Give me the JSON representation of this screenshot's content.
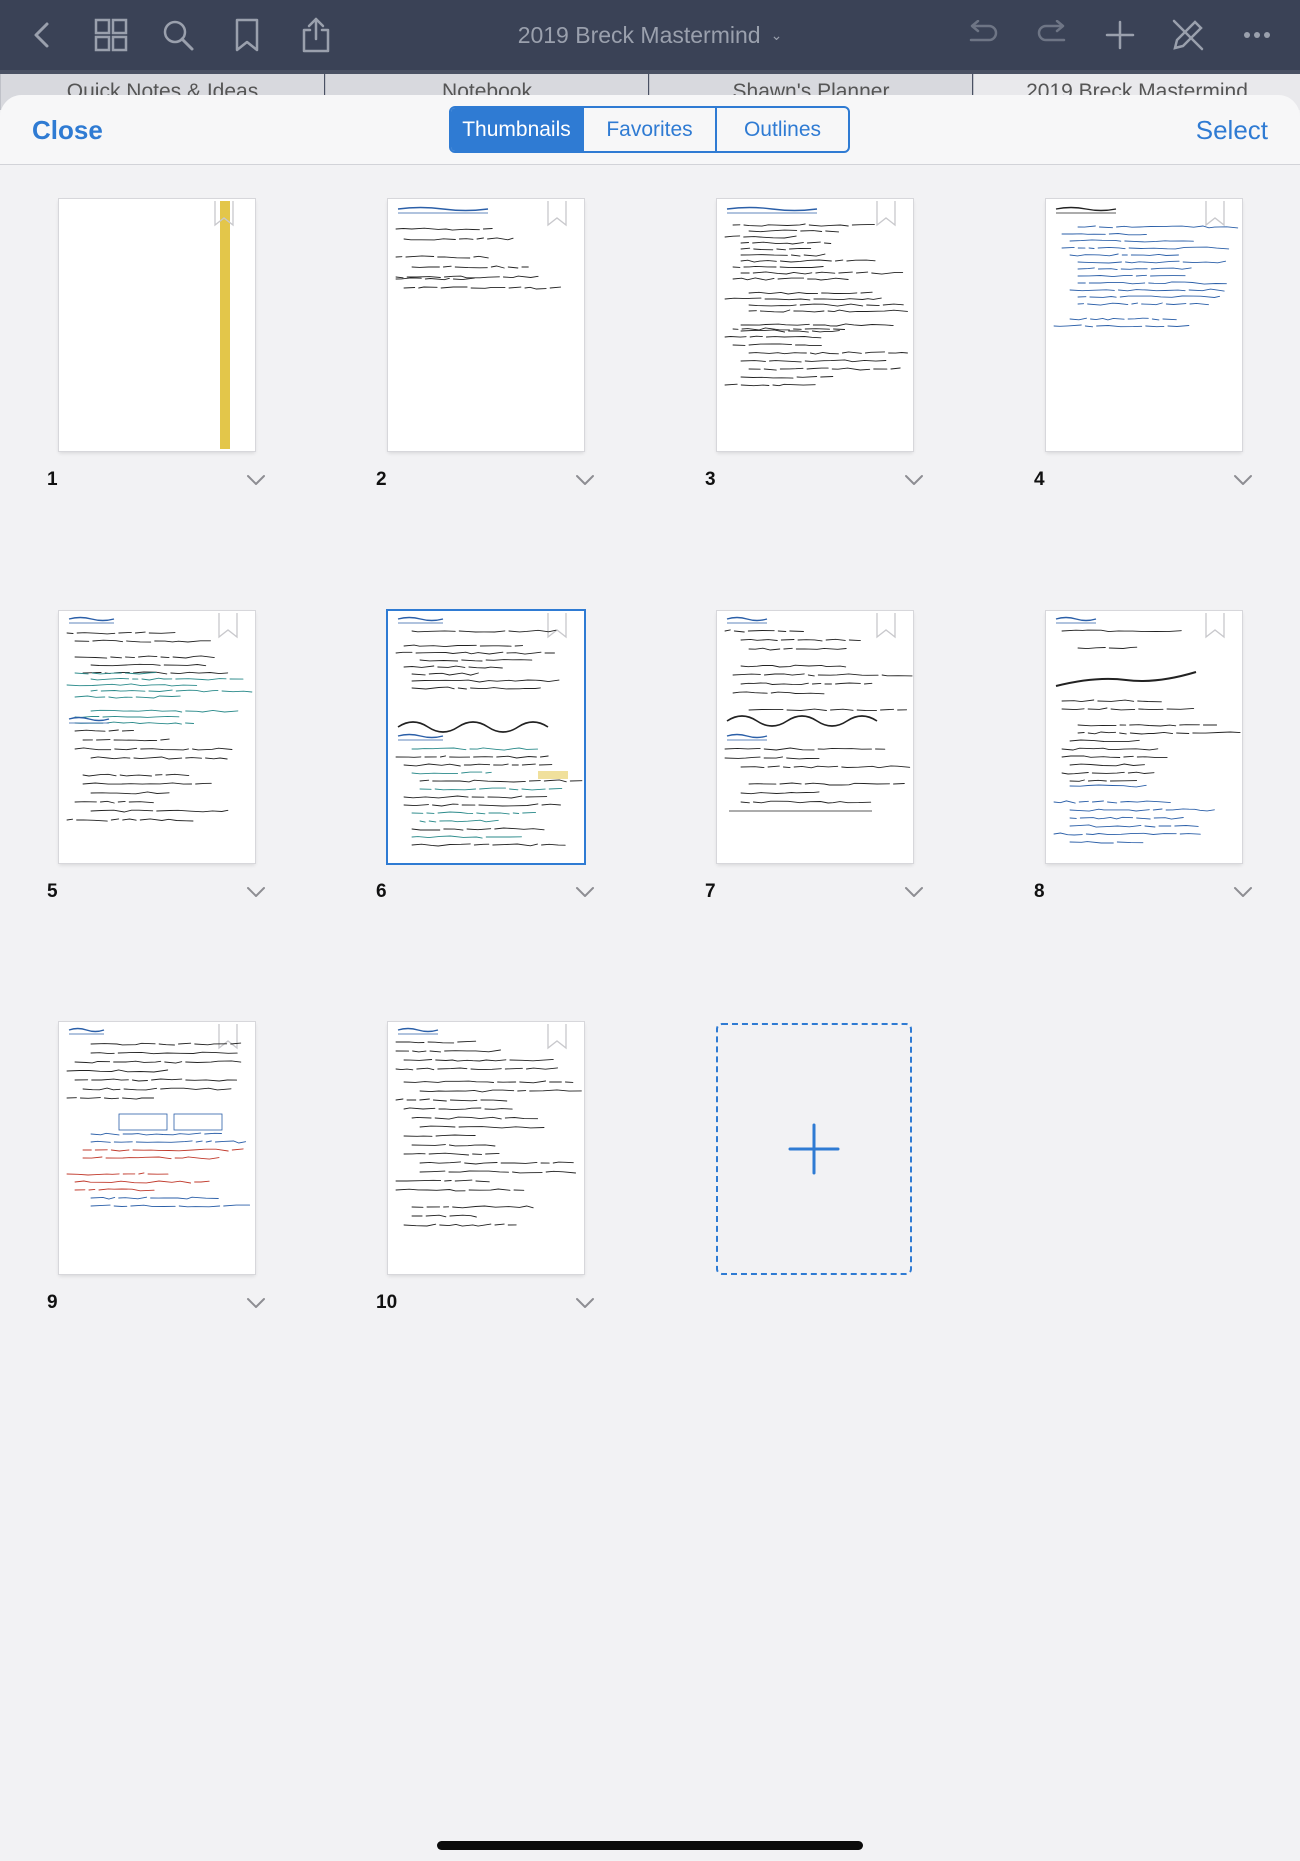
{
  "topbar": {
    "title": "2019 Breck Mastermind",
    "icons": [
      "back-icon",
      "grid-icon",
      "search-icon",
      "bookmark-icon",
      "share-icon",
      "undo-icon",
      "redo-icon",
      "add-icon",
      "pen-off-icon",
      "more-icon"
    ]
  },
  "tabs": [
    {
      "label": "Quick Notes & Ideas"
    },
    {
      "label": "Notebook"
    },
    {
      "label": "Shawn's Planner"
    },
    {
      "label": "2019 Breck Mastermind"
    }
  ],
  "sheet": {
    "close_label": "Close",
    "select_label": "Select",
    "segments": [
      "Thumbnails",
      "Favorites",
      "Outlines"
    ],
    "active_segment": "Thumbnails"
  },
  "pages": [
    {
      "number": "1"
    },
    {
      "number": "2"
    },
    {
      "number": "3"
    },
    {
      "number": "4"
    },
    {
      "number": "5"
    },
    {
      "number": "6",
      "selected": true
    },
    {
      "number": "7"
    },
    {
      "number": "8"
    },
    {
      "number": "9"
    },
    {
      "number": "10"
    }
  ],
  "colors": {
    "accent": "#2f7bd3",
    "topbar": "#3a4256",
    "ink_blue": "#2b5fa8",
    "ink_black": "#222222",
    "ink_red": "#c0392b",
    "ink_teal": "#2a8a8a",
    "highlight_yellow": "#e3c64a"
  }
}
